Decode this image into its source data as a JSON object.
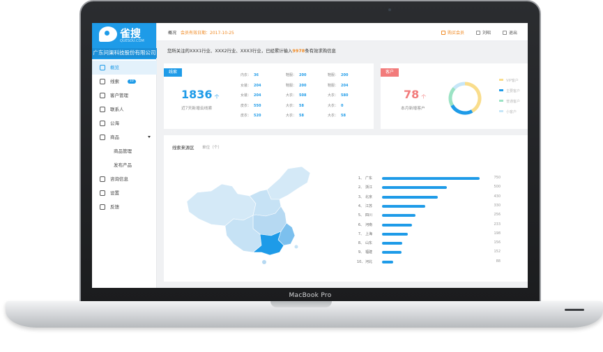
{
  "device": {
    "label": "MacBook Pro"
  },
  "sidebar": {
    "logo_text": "雀搜",
    "logo_sub": "QUESOU.COM",
    "company": "广东问渠科技股份有限公司",
    "items": [
      {
        "label": "概览",
        "icon": "user-icon",
        "active": true
      },
      {
        "label": "线索",
        "icon": "cart-icon",
        "badge": "10"
      },
      {
        "label": "客户管理",
        "icon": "person-icon"
      },
      {
        "label": "联系人",
        "icon": "contact-icon"
      },
      {
        "label": "公海",
        "icon": "group-icon"
      },
      {
        "label": "商品",
        "icon": "product-icon",
        "expandable": true
      },
      {
        "label": "商品管理",
        "sub": true
      },
      {
        "label": "发布产品",
        "sub": true
      },
      {
        "label": "咨询信息",
        "icon": "chat-icon"
      },
      {
        "label": "设置",
        "icon": "gear-icon"
      },
      {
        "label": "反馈",
        "icon": "feedback-icon"
      }
    ]
  },
  "header": {
    "title": "概况",
    "member": "会员有效日期：2017-10-25",
    "buy": "购买会员",
    "account": "刘昭",
    "logout": "退出"
  },
  "notice": {
    "prefix": "您所关注的XXX1行业、XXX2行业、XXX3行业，已经累计输入",
    "count": "9978",
    "suffix": "条有效求购信息"
  },
  "leads": {
    "tag": "线索",
    "number": "1836",
    "unit": "个",
    "caption": "近7天新增云线索",
    "grid": [
      [
        "内衣：",
        "36",
        "鞋服：",
        "200",
        "鞋服：",
        "200"
      ],
      [
        "女装：",
        "204",
        "鞋服：",
        "200",
        "鞋服：",
        "204"
      ],
      [
        "女装：",
        "204",
        "大衣：",
        "508",
        "大衣：",
        "580"
      ],
      [
        "皮衣：",
        "550",
        "大衣：",
        "58",
        "大衣：",
        "0"
      ],
      [
        "皮衣：",
        "520",
        "大衣：",
        "58",
        "大衣：",
        "58"
      ]
    ]
  },
  "customers": {
    "tag": "客户",
    "number": "78",
    "unit": "个",
    "caption": "本月新增客户",
    "legend": [
      {
        "label": "VIP客户",
        "color": "#f9dd8c"
      },
      {
        "label": "主要客户",
        "color": "#1e9be8"
      },
      {
        "label": "普通客户",
        "color": "#9be3c4"
      },
      {
        "label": "小客户",
        "color": "#c6e6f8"
      }
    ],
    "donut": [
      0.42,
      0.25,
      0.2,
      0.13
    ]
  },
  "sources": {
    "title": "线索来源区",
    "unit": "单位（个）",
    "ranking": [
      {
        "rank": "1、",
        "name": "广东",
        "value": 750
      },
      {
        "rank": "2、",
        "name": "浙江",
        "value": 500
      },
      {
        "rank": "3、",
        "name": "北京",
        "value": 430
      },
      {
        "rank": "4、",
        "name": "江苏",
        "value": 330
      },
      {
        "rank": "5、",
        "name": "四川",
        "value": 256
      },
      {
        "rank": "6、",
        "name": "河南",
        "value": 233
      },
      {
        "rank": "7、",
        "name": "上海",
        "value": 198
      },
      {
        "rank": "8、",
        "name": "山东",
        "value": 156
      },
      {
        "rank": "9、",
        "name": "福建",
        "value": 152
      },
      {
        "rank": "10、",
        "name": "河北",
        "value": 88
      }
    ],
    "max": 750
  }
}
